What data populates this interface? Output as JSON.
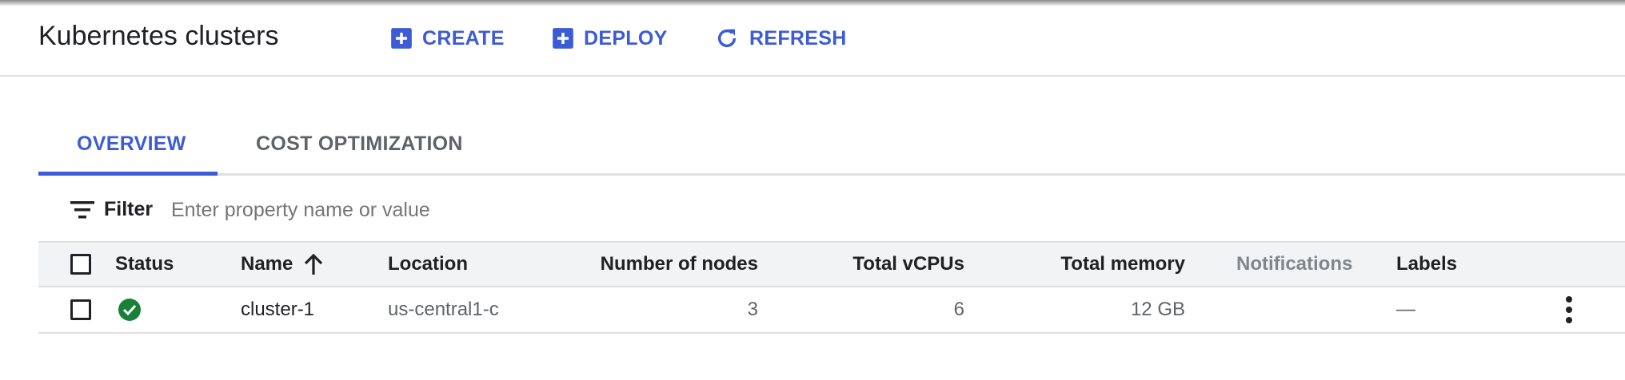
{
  "header": {
    "title": "Kubernetes clusters",
    "actions": {
      "create": "CREATE",
      "deploy": "DEPLOY",
      "refresh": "REFRESH"
    },
    "accent_color": "#3c5bd6"
  },
  "tabs": [
    {
      "label": "OVERVIEW",
      "selected": true
    },
    {
      "label": "COST OPTIMIZATION",
      "selected": false
    }
  ],
  "filter": {
    "label": "Filter",
    "placeholder": "Enter property name or value",
    "value": ""
  },
  "table": {
    "columns": {
      "status": "Status",
      "name": "Name",
      "location": "Location",
      "nodes": "Number of nodes",
      "vcpus": "Total vCPUs",
      "memory": "Total memory",
      "notifications": "Notifications",
      "labels": "Labels"
    },
    "sort": {
      "column": "name",
      "direction": "ascending",
      "icon": "arrow-up-icon"
    },
    "rows": [
      {
        "status": "ok",
        "status_color": "#188038",
        "name": "cluster-1",
        "location": "us-central1-c",
        "nodes": "3",
        "vcpus": "6",
        "memory": "12 GB",
        "notifications": "",
        "labels": "—"
      }
    ]
  },
  "icons": {
    "create": "add-box-icon",
    "deploy": "add-box-icon",
    "refresh": "refresh-icon",
    "filter": "filter-list-icon",
    "row_menu": "more-vert-icon",
    "status_ok": "check-circle-icon"
  }
}
